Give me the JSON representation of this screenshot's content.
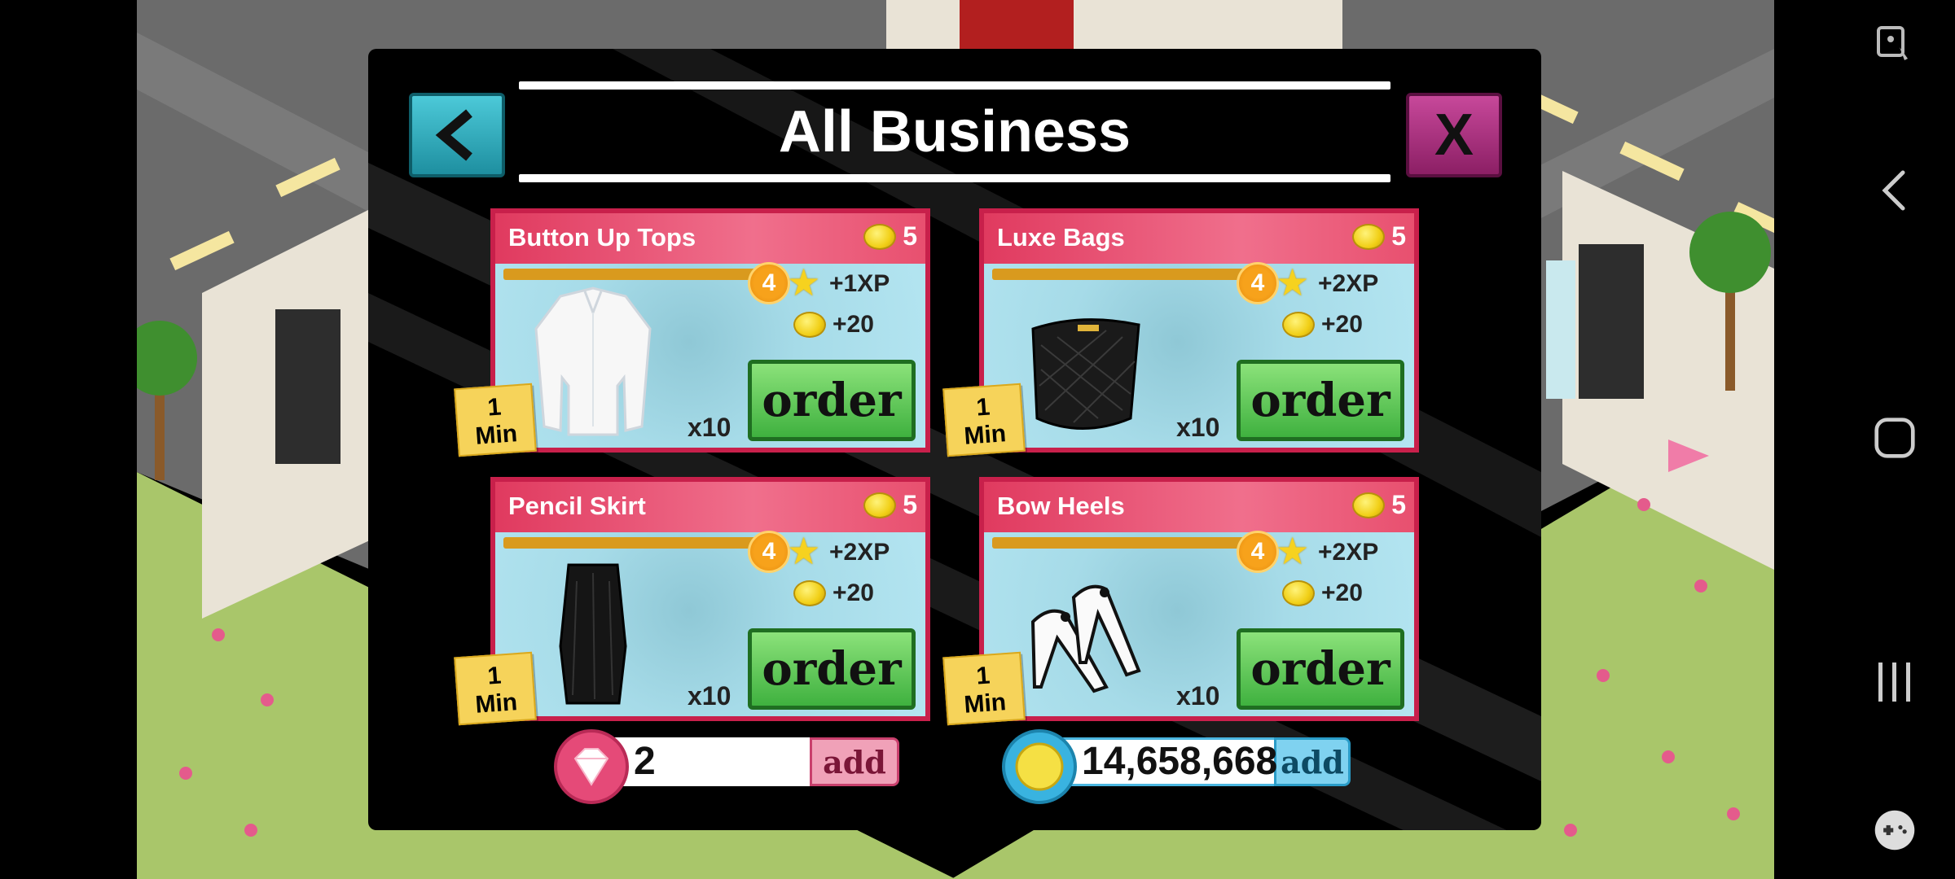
{
  "dialog": {
    "title": "All Business",
    "back_label": "back",
    "close_label": "X"
  },
  "items": [
    {
      "name": "Button Up Tops",
      "cost": "5",
      "level": "4",
      "xp": "+1XP",
      "coins": "+20",
      "qty": "x10",
      "time_num": "1",
      "time_unit": "Min",
      "order_label": "order",
      "icon": "blouse-icon"
    },
    {
      "name": "Luxe Bags",
      "cost": "5",
      "level": "4",
      "xp": "+2XP",
      "coins": "+20",
      "qty": "x10",
      "time_num": "1",
      "time_unit": "Min",
      "order_label": "order",
      "icon": "handbag-icon"
    },
    {
      "name": "Pencil Skirt",
      "cost": "5",
      "level": "4",
      "xp": "+2XP",
      "coins": "+20",
      "qty": "x10",
      "time_num": "1",
      "time_unit": "Min",
      "order_label": "order",
      "icon": "skirt-icon"
    },
    {
      "name": "Bow Heels",
      "cost": "5",
      "level": "4",
      "xp": "+2XP",
      "coins": "+20",
      "qty": "x10",
      "time_num": "1",
      "time_unit": "Min",
      "order_label": "order",
      "icon": "heels-icon"
    }
  ],
  "currency": {
    "gems": {
      "value": "2",
      "add_label": "add"
    },
    "coins": {
      "value": "14,658,668",
      "add_label": "add"
    }
  },
  "colors": {
    "card_border": "#c8204b",
    "order_green": "#3fb13f",
    "back_teal": "#1e8fa0",
    "close_magenta": "#8c1f65"
  }
}
